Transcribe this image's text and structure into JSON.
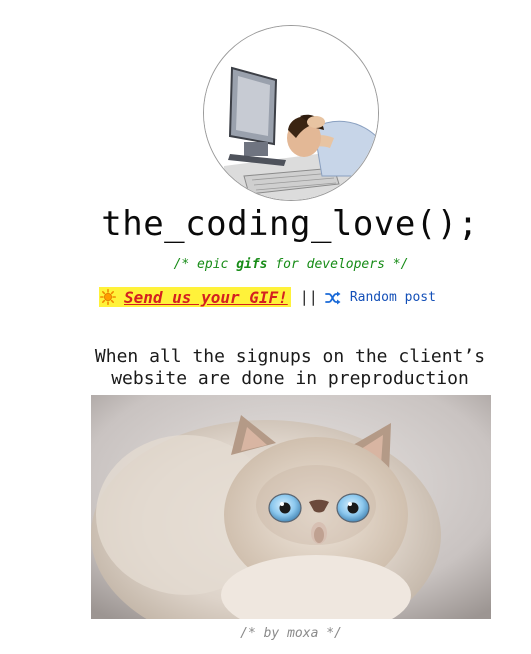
{
  "site": {
    "title": "the_coding_love();",
    "tagline_prefix": "/* epic ",
    "tagline_bold": "gifs",
    "tagline_suffix": " for developers */",
    "logo_icon": "developer-headdesk-avatar"
  },
  "nav": {
    "send_gif_label": "Send us your GIF!",
    "send_gif_icon": "sun-icon",
    "separator": "||",
    "random_label": "Random post",
    "random_icon": "shuffle-icon"
  },
  "post": {
    "title": "When all the signups on the client’s website are done in preproduction",
    "image_alt": "startled-persian-cat-gif",
    "byline": "/* by moxa */"
  },
  "colors": {
    "tagline": "#178c17",
    "send_gif_highlight": "#fff23a",
    "send_gif_text": "#d42020",
    "random_link": "#1450b8",
    "byline": "#8a8a8a"
  }
}
